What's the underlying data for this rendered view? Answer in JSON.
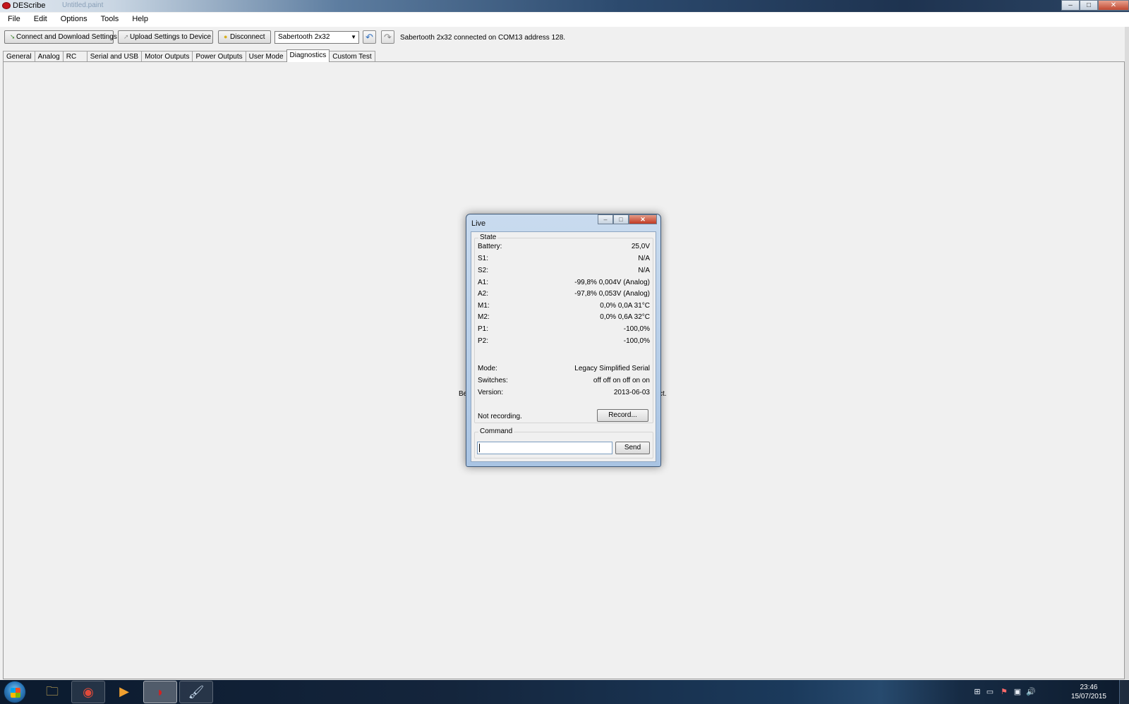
{
  "window": {
    "title": "DEScribe",
    "ghost_tab": "Untitled.paint",
    "controls": {
      "minimize": "–",
      "maximize": "□",
      "close": "✕"
    }
  },
  "menu": [
    "File",
    "Edit",
    "Options",
    "Tools",
    "Help"
  ],
  "toolbar": {
    "connect_label": "Connect and Download Settings",
    "upload_label": "Upload Settings to Device",
    "disconnect_label": "Disconnect",
    "device_selected": "Sabertooth 2x32",
    "undo_icon": "undo-icon",
    "redo_icon": "redo-icon",
    "status": "Sabertooth 2x32 connected on COM13 address 128."
  },
  "tabs": [
    {
      "label": "General"
    },
    {
      "label": "Analog"
    },
    {
      "label": "RC"
    },
    {
      "label": "Serial and USB"
    },
    {
      "label": "Motor Outputs"
    },
    {
      "label": "Power Outputs"
    },
    {
      "label": "User Mode"
    },
    {
      "label": "Diagnostics",
      "active": true
    },
    {
      "label": "Custom Test"
    }
  ],
  "background_hint": {
    "left": "Be",
    "right": "ct."
  },
  "live_dialog": {
    "title": "Live",
    "controls": {
      "minimize": "–",
      "maximize": "□",
      "close": "✕"
    },
    "state_group_label": "State",
    "state": [
      {
        "key": "Battery:",
        "value": "25,0V"
      },
      {
        "key": "S1:",
        "value": "N/A"
      },
      {
        "key": "S2:",
        "value": "N/A"
      },
      {
        "key": "A1:",
        "value": "-99,8% 0,004V  (Analog)"
      },
      {
        "key": "A2:",
        "value": "-97,8% 0,053V  (Analog)"
      },
      {
        "key": "M1:",
        "value": "0,0% 0,0A 31°C"
      },
      {
        "key": "M2:",
        "value": "0,0% 0,6A 32°C"
      },
      {
        "key": "P1:",
        "value": "-100,0%"
      },
      {
        "key": "P2:",
        "value": "-100,0%"
      }
    ],
    "info": [
      {
        "key": "Mode:",
        "value": "Legacy Simplified Serial"
      },
      {
        "key": "Switches:",
        "value": "off off on off on on"
      },
      {
        "key": "Version:",
        "value": "2013-06-03"
      }
    ],
    "recording_status": "Not recording.",
    "record_button": "Record...",
    "command_group_label": "Command",
    "command_value": "",
    "send_button": "Send"
  },
  "taskbar": {
    "apps": [
      {
        "name": "file-explorer-icon",
        "glyph": "🗀"
      },
      {
        "name": "chrome-icon",
        "glyph": "◉"
      },
      {
        "name": "media-player-icon",
        "glyph": "▶"
      },
      {
        "name": "describe-app-icon",
        "glyph": "◗"
      },
      {
        "name": "paint-icon",
        "glyph": "🖌"
      }
    ],
    "clock_time": "23:46",
    "clock_date": "15/07/2015"
  }
}
